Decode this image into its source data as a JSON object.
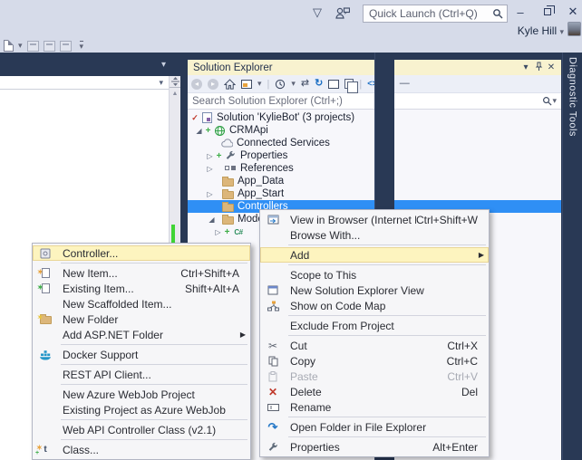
{
  "titlebar": {
    "quick_launch_placeholder": "Quick Launch (Ctrl+Q)",
    "user_name": "Kyle Hill"
  },
  "icons": {
    "dropdown": "▾",
    "submenu_arrow": "▶",
    "collapsed": "▷",
    "expanded": "◢",
    "close": "✕",
    "minimize": "–",
    "notifications": "▽",
    "back": "◂",
    "forward": "▸",
    "sync": "⇄",
    "refresh": "↻",
    "code": "<>",
    "preview_dash": "—",
    "up_arrow": "▲",
    "plus": "+",
    "check": "✓",
    "csharp": "C#",
    "cut": "✂",
    "delete": "✕",
    "open_folder_arrow": "↷",
    "star": "✶"
  },
  "right_tab": {
    "label": "Diagnostic Tools"
  },
  "solution_explorer": {
    "title": "Solution Explorer",
    "search_placeholder": "Search Solution Explorer (Ctrl+;)",
    "tree": {
      "solution": "Solution 'KylieBot' (3 projects)",
      "project": "CRMApi",
      "connected_services": "Connected Services",
      "properties": "Properties",
      "references": "References",
      "app_data": "App_Data",
      "app_start": "App_Start",
      "controllers": "Controllers",
      "models": "Models"
    }
  },
  "context_menu": {
    "items": [
      {
        "label": "View in Browser (Internet Explorer)",
        "shortcut": "Ctrl+Shift+W"
      },
      {
        "label": "Browse With..."
      },
      {
        "label": "Add"
      },
      {
        "label": "Scope to This"
      },
      {
        "label": "New Solution Explorer View"
      },
      {
        "label": "Show on Code Map"
      },
      {
        "label": "Exclude From Project"
      },
      {
        "label": "Cut",
        "shortcut": "Ctrl+X"
      },
      {
        "label": "Copy",
        "shortcut": "Ctrl+C"
      },
      {
        "label": "Paste",
        "shortcut": "Ctrl+V"
      },
      {
        "label": "Delete",
        "shortcut": "Del"
      },
      {
        "label": "Rename"
      },
      {
        "label": "Open Folder in File Explorer"
      },
      {
        "label": "Properties",
        "shortcut": "Alt+Enter"
      }
    ]
  },
  "add_submenu": {
    "items": [
      {
        "label": "Controller..."
      },
      {
        "label": "New Item...",
        "shortcut": "Ctrl+Shift+A"
      },
      {
        "label": "Existing Item...",
        "shortcut": "Shift+Alt+A"
      },
      {
        "label": "New Scaffolded Item..."
      },
      {
        "label": "New Folder"
      },
      {
        "label": "Add ASP.NET Folder"
      },
      {
        "label": "Docker Support"
      },
      {
        "label": "REST API Client..."
      },
      {
        "label": "New Azure WebJob Project"
      },
      {
        "label": "Existing Project as Azure WebJob"
      },
      {
        "label": "Web API Controller Class (v2.1)"
      },
      {
        "label": "Class..."
      }
    ]
  }
}
